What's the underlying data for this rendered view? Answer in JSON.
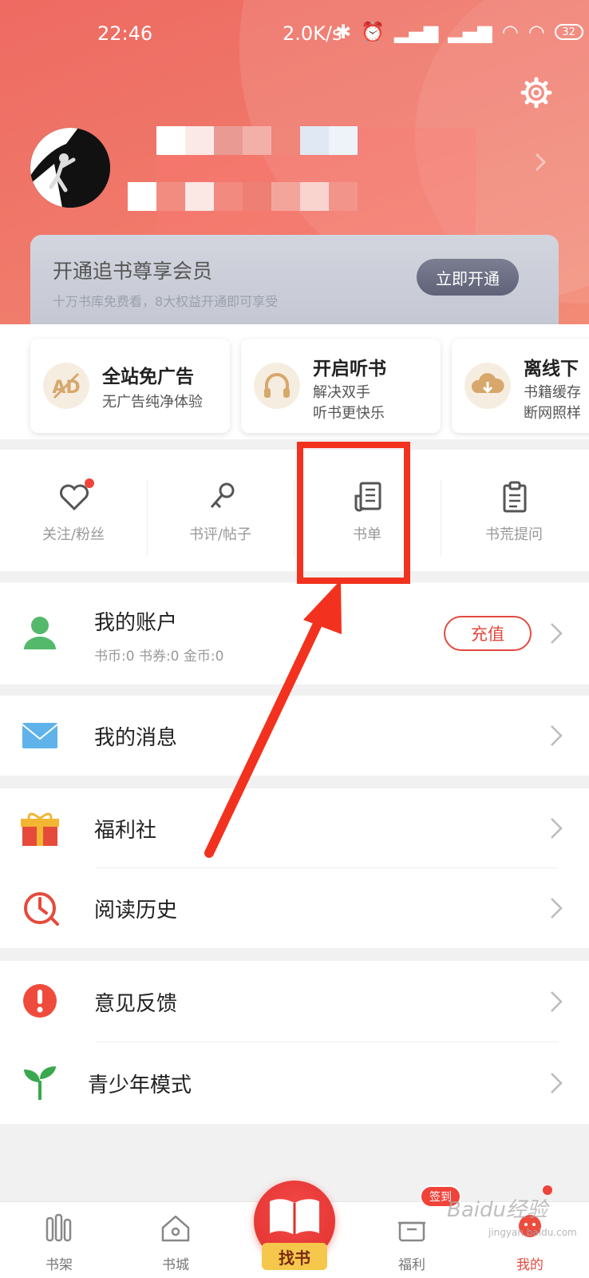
{
  "status_bar": {
    "time": "22:46",
    "speed": "2.0K/s",
    "battery": "32"
  },
  "vip": {
    "title": "开通追书尊享会员",
    "subtitle": "十万书库免费看，8大权益开通即可享受",
    "button": "立即开通"
  },
  "features": [
    {
      "title": "全站免广告",
      "desc": [
        "无广告纯净体验"
      ],
      "icon": "ad-free-icon"
    },
    {
      "title": "开启听书",
      "desc": [
        "解决双手",
        "听书更快乐"
      ],
      "icon": "headphones-icon"
    },
    {
      "title": "离线下",
      "desc": [
        "书籍缓存",
        "断网照样"
      ],
      "icon": "cloud-download-icon"
    }
  ],
  "quick_actions": [
    {
      "label": "关注/粉丝",
      "icon": "heart-icon"
    },
    {
      "label": "书评/帖子",
      "icon": "microphone-icon"
    },
    {
      "label": "书单",
      "icon": "booklist-icon"
    },
    {
      "label": "书荒提问",
      "icon": "clipboard-icon"
    }
  ],
  "account": {
    "title": "我的账户",
    "subtitle": "书币:0   书券:0   金币:0",
    "recharge": "充值"
  },
  "menu": {
    "messages": "我的消息",
    "welfare": "福利社",
    "history": "阅读历史",
    "feedback": "意见反馈",
    "youth": "青少年模式"
  },
  "bottom_nav": {
    "tabs": [
      "书架",
      "书城",
      "福利",
      "我的"
    ],
    "center": "找书",
    "badge": "签到"
  },
  "watermark": {
    "logo": "Baidu经验",
    "url": "jingyan.baidu.com"
  },
  "colors": {
    "primary": "#ee6a62",
    "accent_red": "#e24a3e",
    "annotation": "#f2321e"
  }
}
